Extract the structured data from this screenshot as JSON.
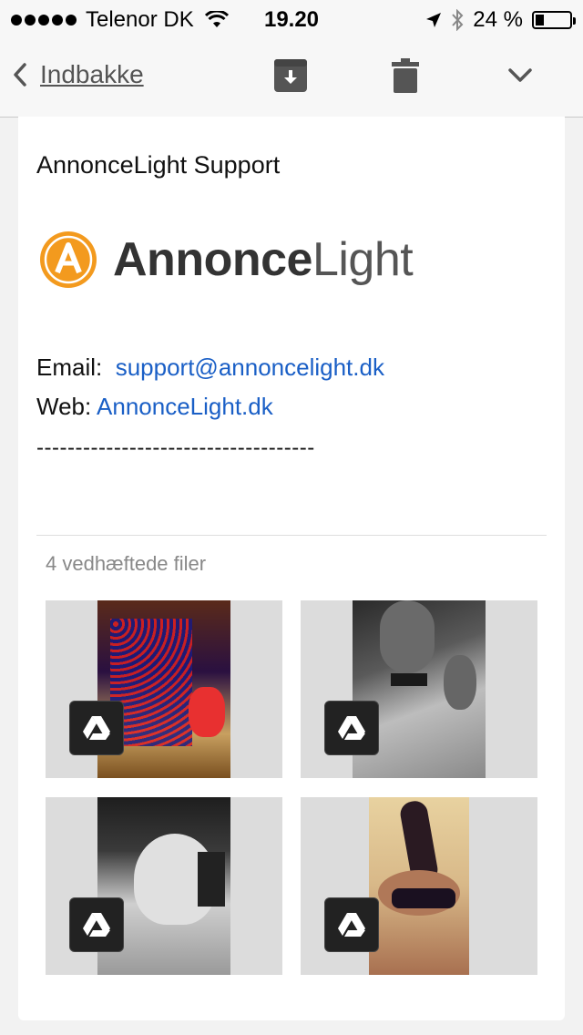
{
  "status_bar": {
    "carrier": "Telenor DK",
    "time": "19.20",
    "battery_text": "24 %",
    "battery_level": 0.24
  },
  "nav": {
    "back_label": "Indbakke"
  },
  "email": {
    "sender_name": "AnnonceLight Support",
    "logo": {
      "part1": "Annonce",
      "part2": "Light",
      "letter": "A"
    },
    "email_label": "Email:",
    "email_value": "support@annoncelight.dk",
    "web_label": "Web:",
    "web_value": "AnnonceLight.dk",
    "separator": "------------------------------------"
  },
  "attachments": {
    "label": "4 vedhæftede filer"
  },
  "colors": {
    "link": "#1a5fc6",
    "logo_orange": "#f39a1e"
  }
}
